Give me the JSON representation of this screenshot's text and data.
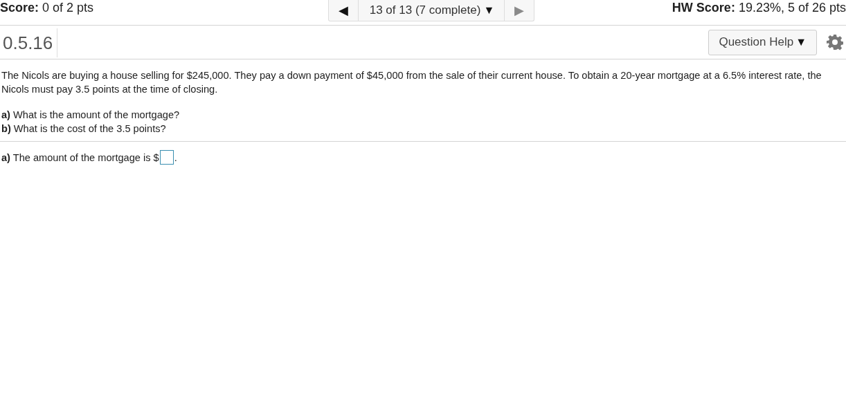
{
  "header": {
    "score_label": "Score:",
    "score_value": "0 of 2 pts",
    "hw_label": "HW Score:",
    "hw_value": "19.23%, 5 of 26 pts"
  },
  "navigator": {
    "prev": {
      "glyph": "◀",
      "disabled": false
    },
    "label": "13 of 13 (7 complete)",
    "dropdown_glyph": "▼",
    "next": {
      "glyph": "▶",
      "disabled": true
    }
  },
  "question": {
    "number": "0.5.16",
    "help_button": {
      "label": "Question Help",
      "glyph": "▼"
    }
  },
  "problem": {
    "text": "The Nicols are buying a house selling for $245,000. They pay a down payment of $45,000 from the sale of their current house. To obtain a 20-year mortgage at a 6.5% interest rate, the Nicols must pay 3.5 points at the time of closing.",
    "parts": [
      "**a)** What is the amount of the mortgage?",
      "**b)** What is the cost of the 3.5 points?"
    ]
  },
  "answer": {
    "prefix": "**a)** The amount of the mortgage is $",
    "suffix": "."
  }
}
